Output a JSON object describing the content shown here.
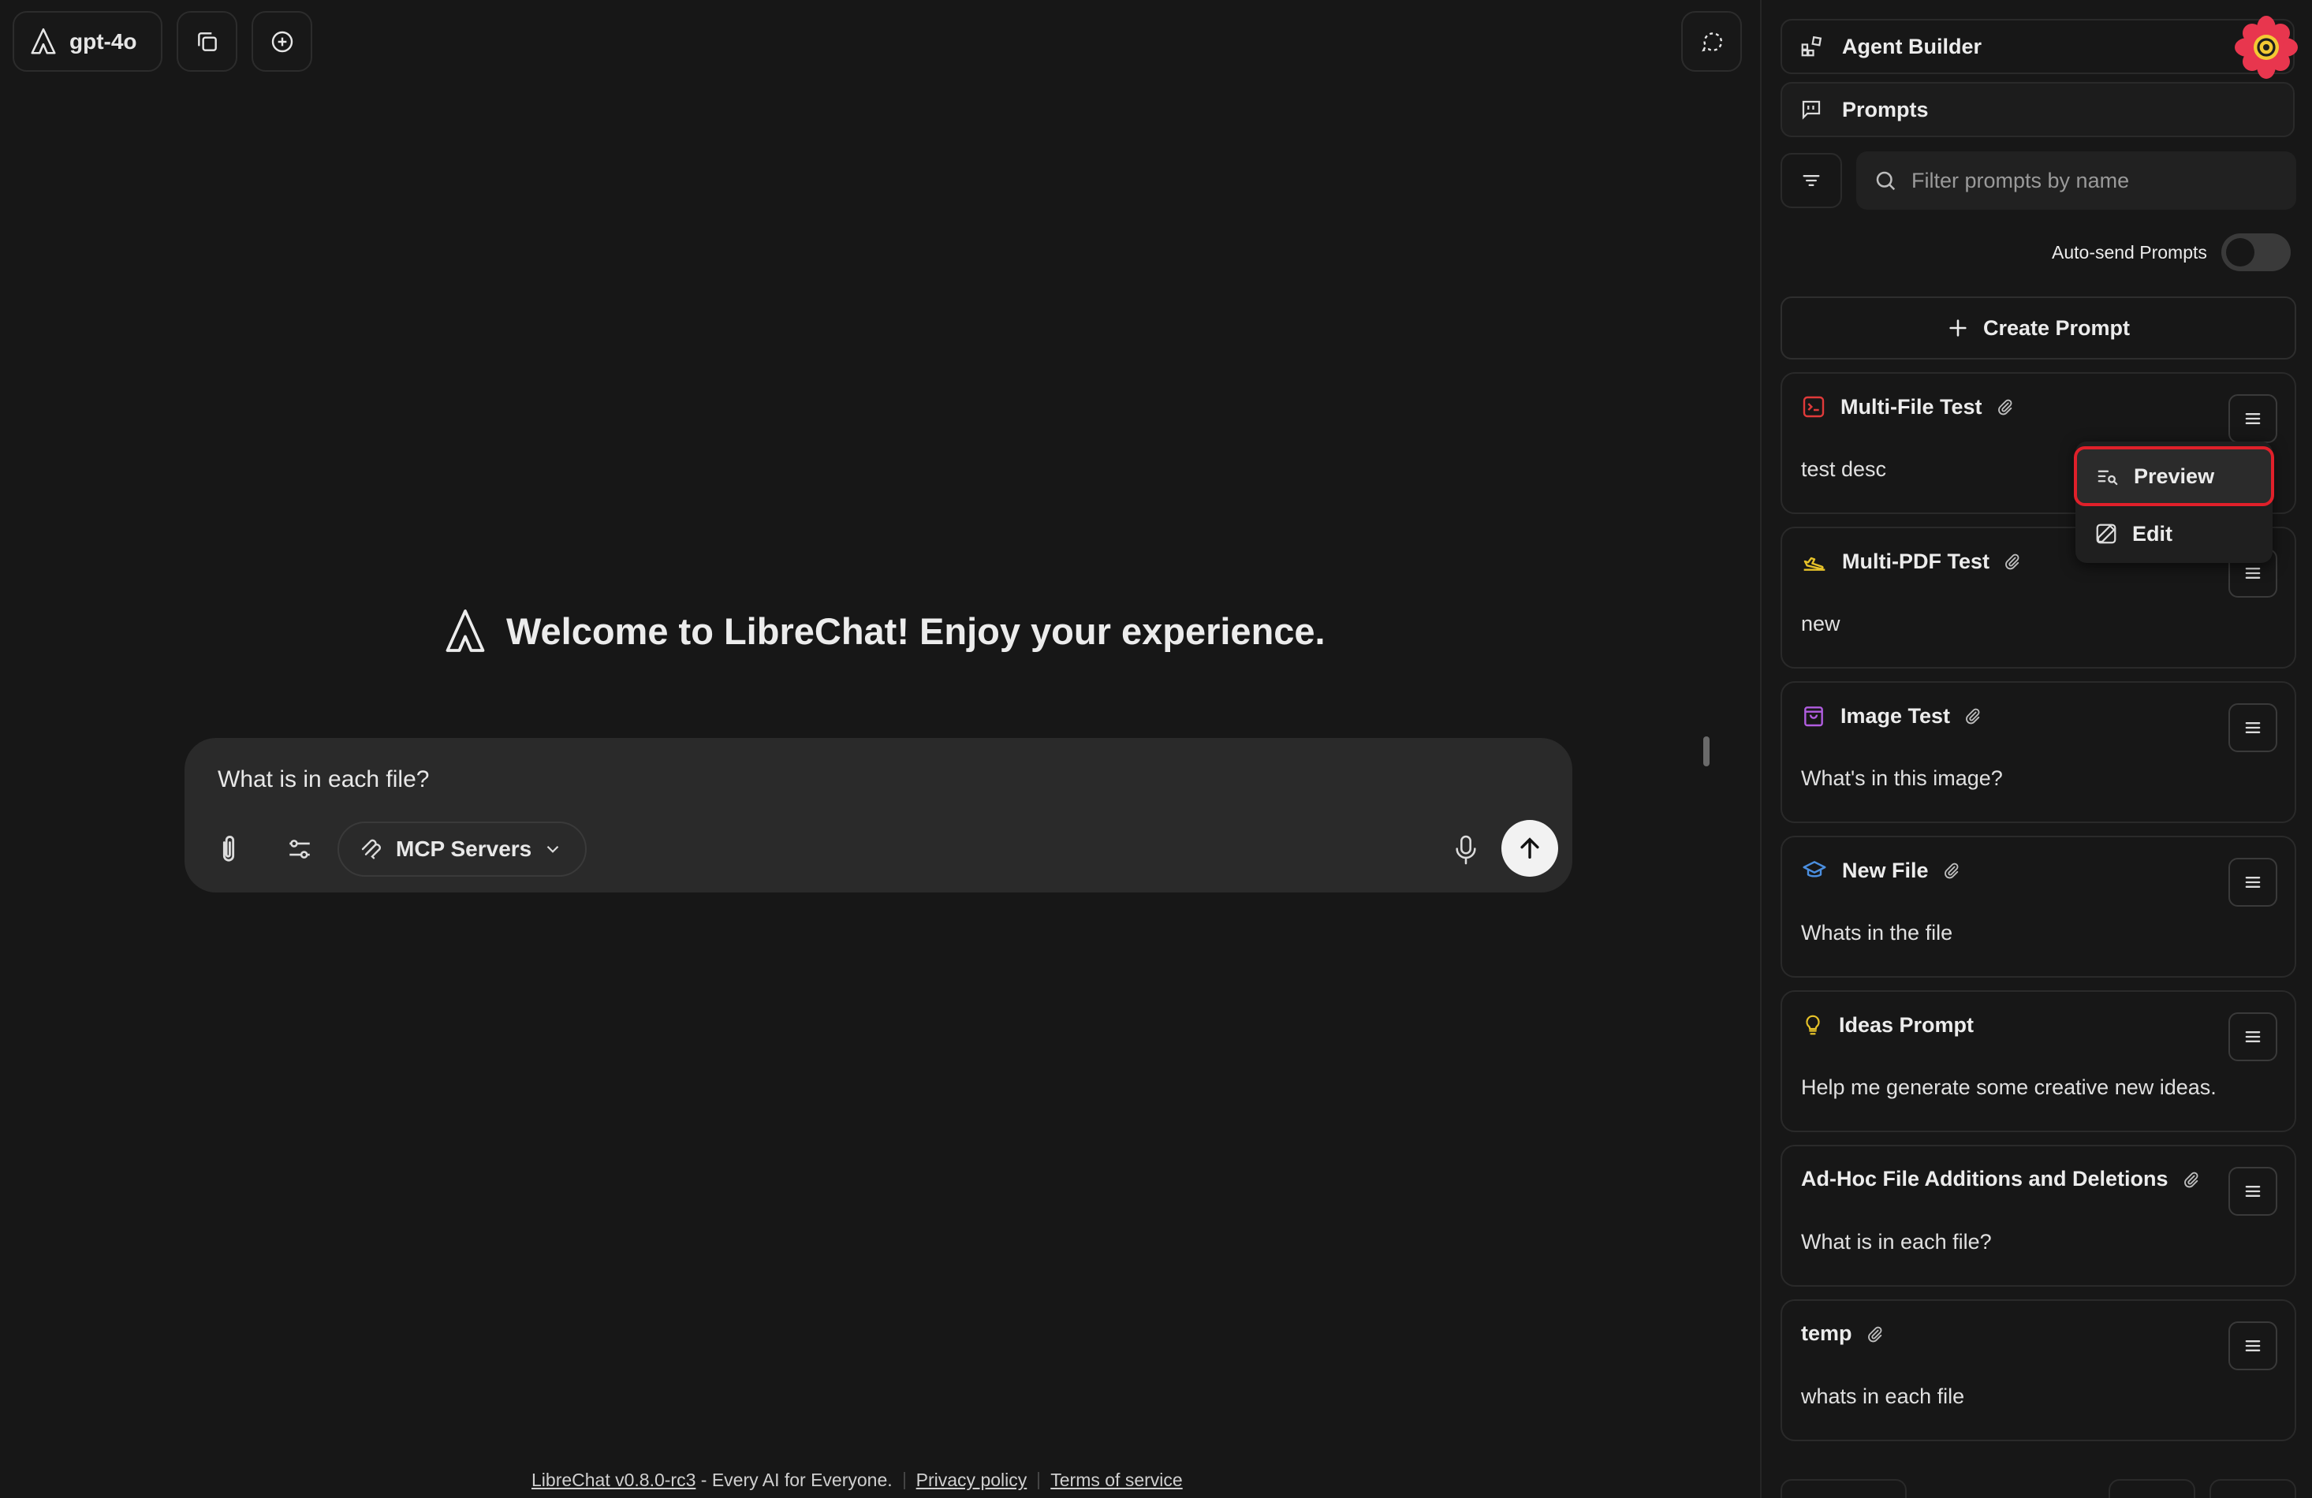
{
  "header": {
    "model_label": "gpt-4o"
  },
  "main": {
    "welcome_text": "Welcome to LibreChat! Enjoy your experience.",
    "composer_text": "What is in each file?",
    "mcp_label": "MCP Servers"
  },
  "footer": {
    "version_link": "LibreChat v0.8.0-rc3",
    "tagline": " - Every AI for Everyone.",
    "privacy": "Privacy policy",
    "terms": "Terms of service"
  },
  "panel": {
    "agent_builder": "Agent Builder",
    "prompts": "Prompts",
    "filter_placeholder": "Filter prompts by name",
    "autosend_label": "Auto-send Prompts",
    "autosend_on": false,
    "create_prompt": "Create Prompt",
    "prompts_list": [
      {
        "name": "Multi-File Test",
        "desc": "test desc",
        "icon": "terminal-icon",
        "color": "#e03a3a",
        "attach": true
      },
      {
        "name": "Multi-PDF Test",
        "desc": "new",
        "icon": "airplane-icon",
        "color": "#e6c229",
        "attach": true
      },
      {
        "name": "Image Test",
        "desc": "What's in this image?",
        "icon": "shopping-bag-icon",
        "color": "#b15de0",
        "attach": true
      },
      {
        "name": "New File",
        "desc": "Whats in the file",
        "icon": "graduation-cap-icon",
        "color": "#4b8fe0",
        "attach": true
      },
      {
        "name": "Ideas Prompt",
        "desc": "Help me generate some creative new ideas.",
        "icon": "lightbulb-icon",
        "color": "#e6c229",
        "attach": false
      },
      {
        "name": "Ad-Hoc File Additions and Deletions",
        "desc": "What is in each file?",
        "icon": "",
        "color": "",
        "attach": true
      },
      {
        "name": "temp",
        "desc": "whats in each file",
        "icon": "",
        "color": "",
        "attach": true
      }
    ]
  },
  "dropdown": {
    "preview": "Preview",
    "edit": "Edit"
  },
  "colors": {
    "highlight": "#e0202a",
    "background": "#171717",
    "composer": "#2a2a2a"
  }
}
